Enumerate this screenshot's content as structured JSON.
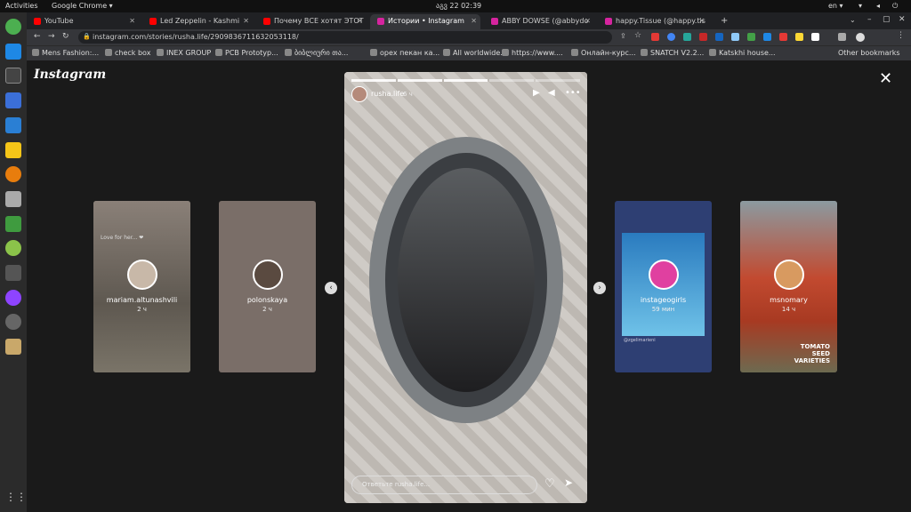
{
  "os": {
    "activities": "Activities",
    "app": "Google Chrome ▾",
    "clock": "აგვ 22  02:39",
    "lang": "en ▾"
  },
  "tabs": [
    {
      "title": "YouTube",
      "color": "#ff0000"
    },
    {
      "title": "Led Zeppelin - Kashmi",
      "color": "#ff0000"
    },
    {
      "title": "Почему ВСЕ хотят ЭТОТ",
      "color": "#ff0000"
    },
    {
      "title": "Истории • Instagram",
      "color": "#d6249f"
    },
    {
      "title": "ABBY DOWSE (@abbydo",
      "color": "#d6249f"
    },
    {
      "title": "happy.Tissue (@happy.tis",
      "color": "#d6249f"
    }
  ],
  "url": "instagram.com/stories/rusha.life/2909836711632053118/",
  "bookmarks": [
    "Mens Fashion:...",
    "check box",
    "INEX GROUP",
    "PCB Prototyp...",
    "ბიბლიური თა...",
    "орех пекан ка...",
    "All worldwide...",
    "https://www....",
    "Онлайн-курс...",
    "SNATCH V2.2...",
    "Katskhi house..."
  ],
  "other_bookmarks": "Other bookmarks",
  "logo": "Instagram",
  "stories": [
    {
      "user": "mariam.altunashvili",
      "time": "2 ч",
      "bg": "#6e6a64",
      "av": "#c8b8a8"
    },
    {
      "user": "polonskaya",
      "time": "2 ч",
      "bg": "#7a6e68",
      "av": "#5a4a40"
    },
    {
      "user": "instageogirls",
      "time": "59 мин",
      "bg": "#2e3f73",
      "av": "#e040a0"
    },
    {
      "user": "msnomary",
      "time": "14 ч",
      "bg": "#5b4a3d",
      "av": "#d89a60"
    }
  ],
  "card_extras": {
    "love": "Love for her... ❤",
    "handle": "@zgelimarieni",
    "tomato": "TOMATO\nSEED\nVARIETIES"
  },
  "main_story": {
    "user": "rusha.life",
    "time": "6 ч",
    "reply_placeholder": "Ответьте rusha.life..."
  }
}
